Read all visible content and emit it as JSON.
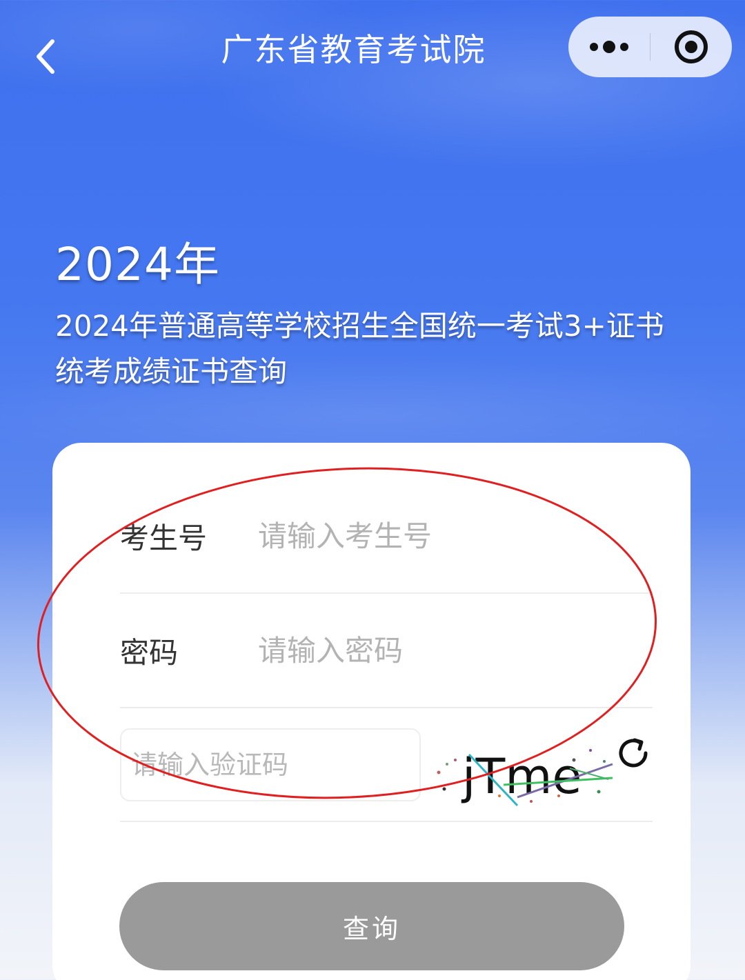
{
  "nav": {
    "title": "广东省教育考试院",
    "back_icon": "chevron-left-icon",
    "more_icon": "more-dots-icon",
    "close_icon": "target-circle-icon"
  },
  "header": {
    "year": "2024年",
    "subtitle_line1": "2024年普通高等学校招生全国统一考试3+证书",
    "subtitle_line2": "统考成绩证书查询"
  },
  "form": {
    "exam_id": {
      "label": "考生号",
      "placeholder": "请输入考生号",
      "value": ""
    },
    "password": {
      "label": "密码",
      "placeholder": "请输入密码",
      "value": ""
    },
    "captcha": {
      "placeholder": "请输入验证码",
      "value": "",
      "image_text": "jTme"
    },
    "submit_label": "查询"
  },
  "colors": {
    "primary_blue": "#4477f0",
    "button_gray": "#9a9a9a",
    "annotation_red": "#e02020",
    "placeholder_gray": "#b3b3b3",
    "label_dark": "#333333"
  }
}
